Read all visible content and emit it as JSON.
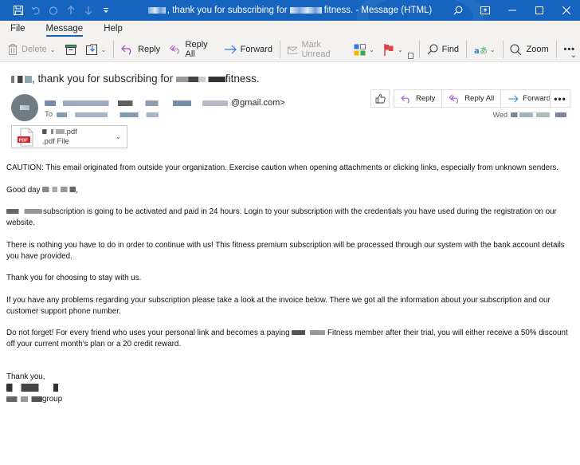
{
  "window": {
    "title_suffix_1": ", thank you for subscribing for",
    "title_suffix_2": "fitness.  -  Message (HTML)",
    "quick_access": [
      "save-icon",
      "undo-icon",
      "redo-icon",
      "up-arrow-icon",
      "down-arrow-icon",
      "customize-quick-access-icon"
    ],
    "controls": [
      "search-icon",
      "ribbon-display-icon",
      "minimize-icon",
      "maximize-icon",
      "close-icon"
    ]
  },
  "menu": {
    "tabs": [
      {
        "label": "File",
        "active": false
      },
      {
        "label": "Message",
        "active": true
      },
      {
        "label": "Help",
        "active": false
      }
    ]
  },
  "ribbon": {
    "delete": "Delete",
    "reply": "Reply",
    "reply_all": "Reply All",
    "forward": "Forward",
    "mark_unread": "Mark Unread",
    "find": "Find",
    "zoom": "Zoom",
    "more": "•••"
  },
  "message": {
    "subject_mid": ", thank you for subscribing for ",
    "subject_end": "fitness.",
    "sender_suffix": "@gmail.com>",
    "to_label": "To",
    "date_prefix": "Wed",
    "attachment": {
      "name_suffix": ".pdf",
      "type": ".pdf File",
      "icon_label": "PDF"
    },
    "actions": {
      "reply": "Reply",
      "reply_all": "Reply All",
      "forward": "Forward",
      "more": "•••"
    }
  },
  "body": {
    "caution": "CAUTION: This email originated from outside your organization. Exercise caution when opening attachments or clicking links, especially from unknown senders.",
    "greeting": "Good day ",
    "greeting_end": ",",
    "p1": "subscription is going to be activated and paid in 24 hours. Login to your subscription with the credentials you have used during the registration on our website.",
    "p2": "There is nothing you have to do in order to continue with us! This fitness premium subscription will be processed through our system with the bank account details you have provided.",
    "p3": "Thank you for choosing to stay with us.",
    "p4": "If you have any problems regarding your subscription please take a look at the invoice below. There we got all the information about your subscription and our customer support phone number.",
    "p5_start": "Do not forget! For every friend who uses your personal link and becomes a paying ",
    "p5_end": " Fitness member after their trial, you will either receive a 50% discount off your current month’s plan or a 20 credit reward.",
    "signoff": "Thank you,",
    "sig_group": "group"
  },
  "colors": {
    "titlebar": "#1664c0",
    "reply_purple": "#a24ac0",
    "forward_blue": "#2b7cd3",
    "pdf_red": "#d8232a"
  }
}
